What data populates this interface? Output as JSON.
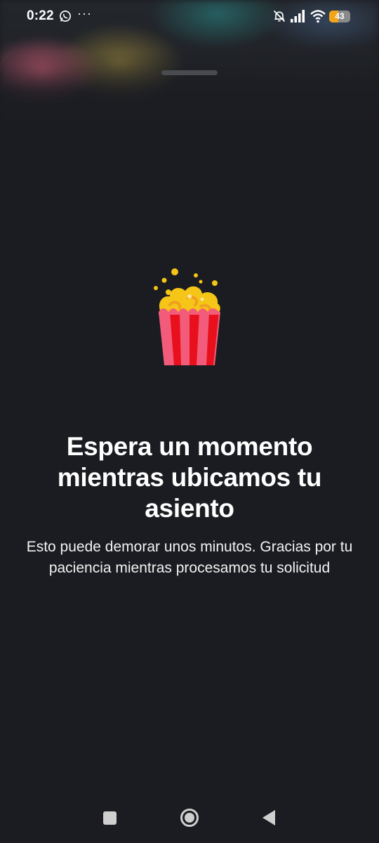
{
  "status_bar": {
    "time": "0:22",
    "more_indicator": "···",
    "battery_level": "43",
    "icons": [
      "whatsapp-icon",
      "more-icon",
      "bell-off-icon",
      "signal-icon",
      "wifi-icon",
      "battery-icon"
    ]
  },
  "loading": {
    "icon": "popcorn-icon",
    "title": "Espera un momento mientras ubicamos tu asiento",
    "subtitle": "Esto puede demorar unos minutos. Gracias por tu paciencia mientras procesamos tu solicitud"
  },
  "nav_bar": {
    "icons": [
      "recents-icon",
      "home-icon",
      "back-icon"
    ]
  },
  "colors": {
    "background": "#1b1c21",
    "text": "#ffffff",
    "battery_accent": "#f2a51a",
    "popcorn_red": "#e8101c",
    "popcorn_pink": "#f25c7a",
    "popcorn_yellow": "#f5c518"
  }
}
